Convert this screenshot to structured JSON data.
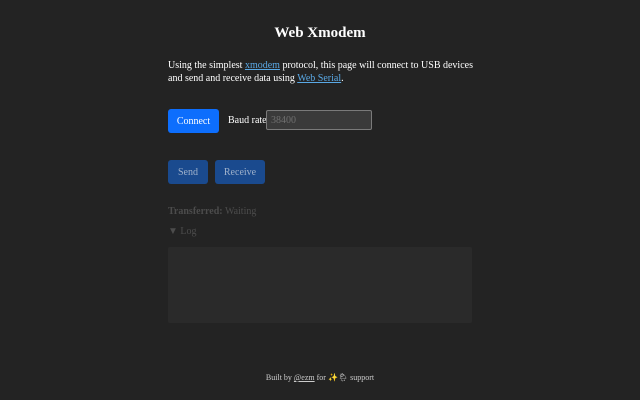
{
  "page": {
    "title": "Web Xmodem"
  },
  "intro": {
    "text_before": "Using the simplest ",
    "xmodem_link": "xmodem",
    "text_middle": " protocol, this page will connect to USB devices and send and receive data using ",
    "webserial_link": "Web Serial",
    "text_after": "."
  },
  "controls": {
    "connect_label": "Connect",
    "baud_label": "Baud rate:",
    "baud_placeholder": "38400",
    "send_label": "Send",
    "receive_label": "Receive"
  },
  "status": {
    "transferred_label": "Transferred:",
    "transferred_value": "Waiting"
  },
  "log": {
    "toggle_icon": "▼",
    "label": "Log"
  },
  "footer": {
    "built_by": "Built by ",
    "author_link": "@ezm",
    "for_text": " for ",
    "emoji": "✨🌦",
    "support_text": " support"
  },
  "colors": {
    "background": "#232323",
    "primary_button": "#0d6efd",
    "disabled_button": "#1a4a8e",
    "link": "#5aa9e6"
  }
}
